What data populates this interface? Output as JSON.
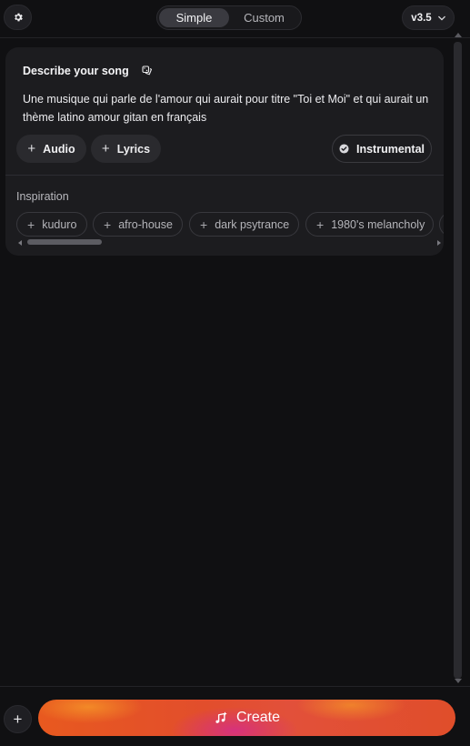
{
  "header": {
    "settings_icon": "gear-icon",
    "mode_tabs": [
      {
        "label": "Simple",
        "active": true
      },
      {
        "label": "Custom",
        "active": false
      }
    ],
    "version": "v3.5"
  },
  "card": {
    "title": "Describe your song",
    "title_icon": "dice-icon",
    "prompt": "Une musique qui parle de l'amour qui aurait pour titre \"Toi et Moi\" et qui aurait un thème latino amour  gitan en français",
    "audio_label": "Audio",
    "lyrics_label": "Lyrics",
    "instrumental_label": "Instrumental",
    "inspiration_label": "Inspiration",
    "inspiration_chips": [
      "kuduro",
      "afro-house",
      "dark psytrance",
      "1980's melancholy"
    ]
  },
  "footer": {
    "create_label": "Create",
    "create_icon": "music-note-icon",
    "colors": {
      "create_orange": "#e8591f",
      "create_pink": "#d63081"
    }
  }
}
